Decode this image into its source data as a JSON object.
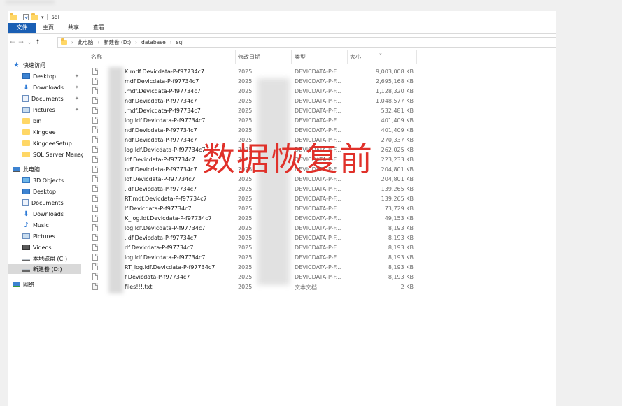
{
  "window": {
    "quick_access_title": "sql",
    "dropdown_arrow": "▾"
  },
  "ribbon": {
    "tabs": [
      "文件",
      "主页",
      "共享",
      "查看"
    ]
  },
  "address": {
    "back": "←",
    "forward": "→",
    "recent": "⌄",
    "up": "↑",
    "crumbs": [
      "此电脑",
      "新建卷 (D:)",
      "database",
      "sql"
    ],
    "separator": "›"
  },
  "sidebar": {
    "pin_glyph": "📌",
    "quick_access": {
      "label": "快速访问",
      "items": [
        {
          "label": "Desktop",
          "icon": "desktop-icon",
          "pinned": true
        },
        {
          "label": "Downloads",
          "icon": "downloads-icon",
          "pinned": true
        },
        {
          "label": "Documents",
          "icon": "documents-icon",
          "pinned": true
        },
        {
          "label": "Pictures",
          "icon": "pictures-icon",
          "pinned": true
        },
        {
          "label": "bin",
          "icon": "folder-icon",
          "pinned": false
        },
        {
          "label": "Kingdee",
          "icon": "folder-icon",
          "pinned": false
        },
        {
          "label": "KingdeeSetup",
          "icon": "folder-icon",
          "pinned": false
        },
        {
          "label": "SQL Server Management",
          "icon": "folder-icon",
          "pinned": false
        }
      ]
    },
    "this_pc": {
      "label": "此电脑",
      "items": [
        {
          "label": "3D Objects",
          "icon": "3d-objects-icon"
        },
        {
          "label": "Desktop",
          "icon": "desktop-icon"
        },
        {
          "label": "Documents",
          "icon": "documents-icon"
        },
        {
          "label": "Downloads",
          "icon": "downloads-icon"
        },
        {
          "label": "Music",
          "icon": "music-icon"
        },
        {
          "label": "Pictures",
          "icon": "pictures-icon"
        },
        {
          "label": "Videos",
          "icon": "videos-icon"
        },
        {
          "label": "本地磁盘 (C:)",
          "icon": "drive-icon"
        },
        {
          "label": "新建卷 (D:)",
          "icon": "drive-icon",
          "selected": true
        }
      ]
    },
    "network": {
      "label": "网络",
      "icon": "network-icon"
    }
  },
  "columns": {
    "name": "名称",
    "date": "修改日期",
    "type": "类型",
    "size": "大小",
    "sort_indicator": "⌄"
  },
  "files": [
    {
      "name": "K.mdf.Devicdata-P-f97734c7",
      "date": "2025",
      "type": "DEVICDATA-P-F...",
      "size": "9,003,008 KB"
    },
    {
      "name": "mdf.Devicdata-P-f97734c7",
      "date": "2025",
      "type": "DEVICDATA-P-F...",
      "size": "2,695,168 KB"
    },
    {
      "name": ".mdf.Devicdata-P-f97734c7",
      "date": "2025",
      "type": "DEVICDATA-P-F...",
      "size": "1,128,320 KB"
    },
    {
      "name": "ndf.Devicdata-P-f97734c7",
      "date": "2025",
      "type": "DEVICDATA-P-F...",
      "size": "1,048,577 KB"
    },
    {
      "name": ".mdf.Devicdata-P-f97734c7",
      "date": "2025",
      "type": "DEVICDATA-P-F...",
      "size": "532,481 KB"
    },
    {
      "name": "log.ldf.Devicdata-P-f97734c7",
      "date": "2025",
      "type": "DEVICDATA-P-F...",
      "size": "401,409 KB"
    },
    {
      "name": "ndf.Devicdata-P-f97734c7",
      "date": "2025",
      "type": "DEVICDATA-P-F...",
      "size": "401,409 KB"
    },
    {
      "name": "ndf.Devicdata-P-f97734c7",
      "date": "2025",
      "type": "DEVICDATA-P-F...",
      "size": "270,337 KB"
    },
    {
      "name": "log.ldf.Devicdata-P-f97734c7",
      "date": "2025",
      "type": "DEVICDATA-P-F...",
      "size": "262,025 KB"
    },
    {
      "name": "ldf.Devicdata-P-f97734c7",
      "date": "2025",
      "type": "DEVICDATA-P-F...",
      "size": "223,233 KB"
    },
    {
      "name": "ndf.Devicdata-P-f97734c7",
      "date": "2025",
      "type": "DEVICDATA-P-F...",
      "size": "204,801 KB"
    },
    {
      "name": "ldf.Devicdata-P-f97734c7",
      "date": "2025",
      "type": "DEVICDATA-P-F...",
      "size": "204,801 KB"
    },
    {
      "name": ".ldf.Devicdata-P-f97734c7",
      "date": "2025",
      "type": "DEVICDATA-P-F...",
      "size": "139,265 KB"
    },
    {
      "name": "RT.mdf.Devicdata-P-f97734c7",
      "date": "2025",
      "type": "DEVICDATA-P-F...",
      "size": "139,265 KB"
    },
    {
      "name": "lf.Devicdata-P-f97734c7",
      "date": "2025",
      "type": "DEVICDATA-P-F...",
      "size": "73,729 KB"
    },
    {
      "name": "K_log.ldf.Devicdata-P-f97734c7",
      "date": "2025",
      "type": "DEVICDATA-P-F...",
      "size": "49,153 KB"
    },
    {
      "name": "log.ldf.Devicdata-P-f97734c7",
      "date": "2025",
      "type": "DEVICDATA-P-F...",
      "size": "8,193 KB"
    },
    {
      "name": ".ldf.Devicdata-P-f97734c7",
      "date": "2025",
      "type": "DEVICDATA-P-F...",
      "size": "8,193 KB"
    },
    {
      "name": "df.Devicdata-P-f97734c7",
      "date": "2025",
      "type": "DEVICDATA-P-F...",
      "size": "8,193 KB"
    },
    {
      "name": "log.ldf.Devicdata-P-f97734c7",
      "date": "2025",
      "type": "DEVICDATA-P-F...",
      "size": "8,193 KB"
    },
    {
      "name": "RT_log.ldf.Devicdata-P-f97734c7",
      "date": "2025",
      "type": "DEVICDATA-P-F...",
      "size": "8,193 KB"
    },
    {
      "name": "f.Devicdata-P-f97734c7",
      "date": "2025",
      "type": "DEVICDATA-P-F...",
      "size": "8,193 KB"
    },
    {
      "name": "files!!!.txt",
      "date": "2025",
      "type": "文本文档",
      "size": "2 KB",
      "icon": "text-file-icon"
    }
  ],
  "overlay": {
    "stamp_text": "数据恢复前",
    "stamp_color": "#e0312a"
  }
}
